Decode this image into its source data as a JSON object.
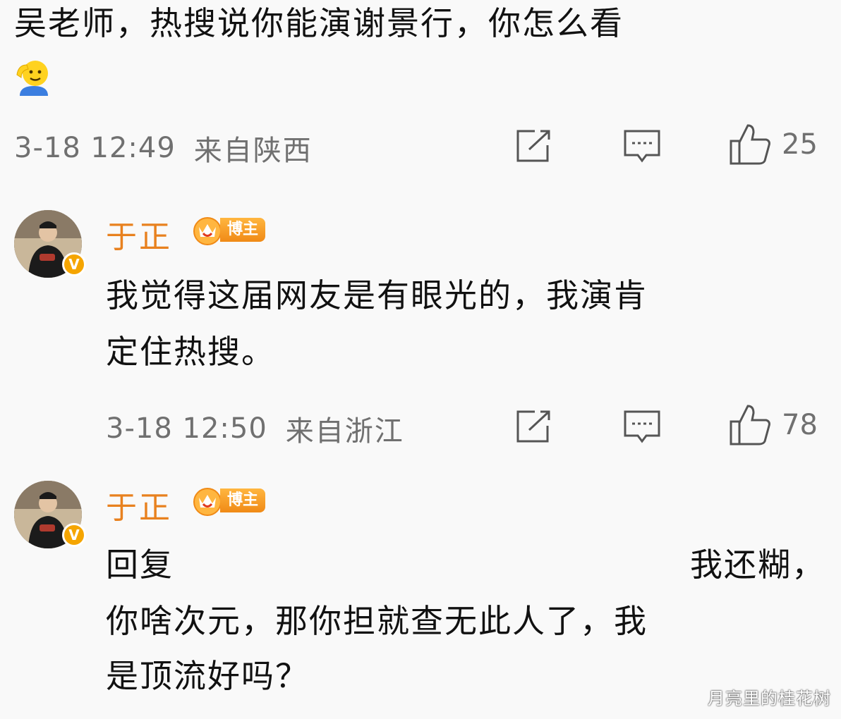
{
  "comment1": {
    "text": "吴老师，热搜说你能演谢景行，你怎么看",
    "emoji": "salute-emoji",
    "time": "3-18 12:49",
    "location": "来自陕西",
    "likes": "25"
  },
  "reply1": {
    "username": "于正",
    "author_badge": "博主",
    "text_line1": "我觉得这届网友是有眼光的，我演肯",
    "text_line2": "定住热搜。",
    "time": "3-18 12:50",
    "location": "来自浙江",
    "likes": "78"
  },
  "reply2": {
    "username": "于正",
    "author_badge": "博主",
    "reply_prefix": "回复",
    "quoted_text": "我还糊，",
    "text_line2": "你啥次元，那你担就查无此人了，我",
    "text_line3": "是顶流好吗？"
  },
  "watermark": "月亮里的桂花树",
  "icons": [
    "share-icon",
    "comment-icon",
    "like-icon",
    "verified-v-icon",
    "crown-icon"
  ],
  "colors": {
    "username": "#e8811f",
    "meta": "#707070",
    "badge": "#f5a500"
  }
}
